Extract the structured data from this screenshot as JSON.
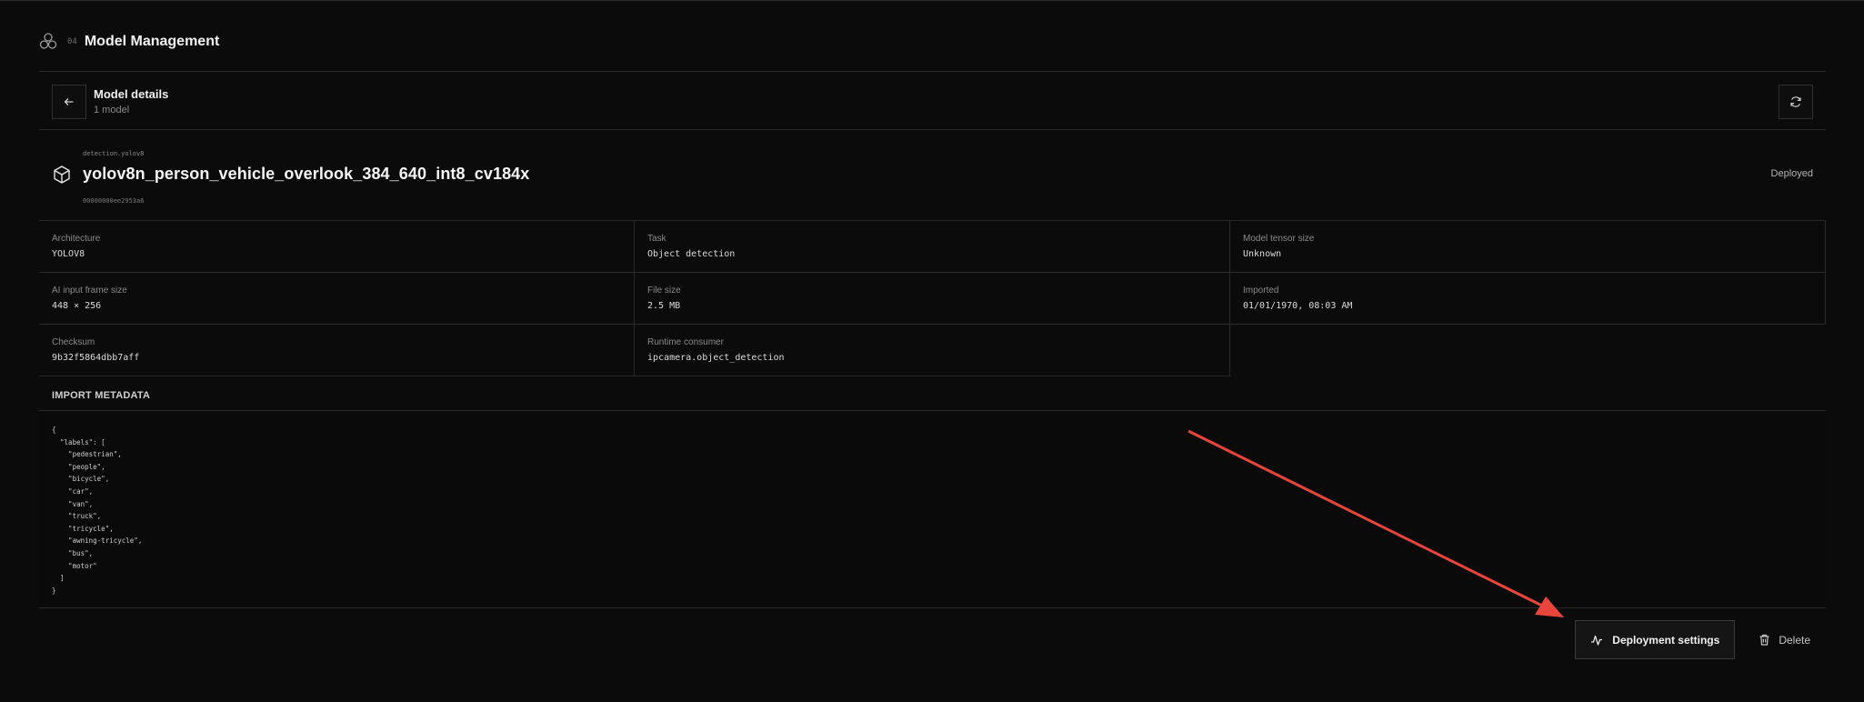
{
  "header": {
    "section_number": "04",
    "title": "Model Management"
  },
  "details": {
    "title": "Model details",
    "subtitle": "1 model"
  },
  "model": {
    "type": "detection.yolov8",
    "name": "yolov8n_person_vehicle_overlook_384_640_int8_cv184x",
    "id": "00000000ee2953a6",
    "status": "Deployed"
  },
  "fields": [
    {
      "label": "Architecture",
      "value": "YOLOV8"
    },
    {
      "label": "Task",
      "value": "Object detection"
    },
    {
      "label": "Model tensor size",
      "value": "Unknown"
    },
    {
      "label": "AI input frame size",
      "value": "448 × 256"
    },
    {
      "label": "File size",
      "value": "2.5 MB"
    },
    {
      "label": "Imported",
      "value": "01/01/1970, 08:03 AM"
    },
    {
      "label": "Checksum",
      "value": "9b32f5864dbb7aff"
    },
    {
      "label": "Runtime consumer",
      "value": "ipcamera.object_detection"
    }
  ],
  "import_metadata": {
    "title": "IMPORT METADATA",
    "json_text": "{\n  \"labels\": [\n    \"pedestrian\",\n    \"people\",\n    \"bicycle\",\n    \"car\",\n    \"van\",\n    \"truck\",\n    \"tricycle\",\n    \"awning-tricycle\",\n    \"bus\",\n    \"motor\"\n  ]\n}"
  },
  "actions": {
    "deploy_label": "Deployment settings",
    "delete_label": "Delete"
  },
  "colors": {
    "background": "#0b0b0b",
    "border": "#2a2a2a",
    "annotation_arrow": "#e8453c"
  },
  "icons": [
    "logo-icon",
    "back-arrow-icon",
    "refresh-icon",
    "cube-icon",
    "activity-icon",
    "trash-icon"
  ]
}
